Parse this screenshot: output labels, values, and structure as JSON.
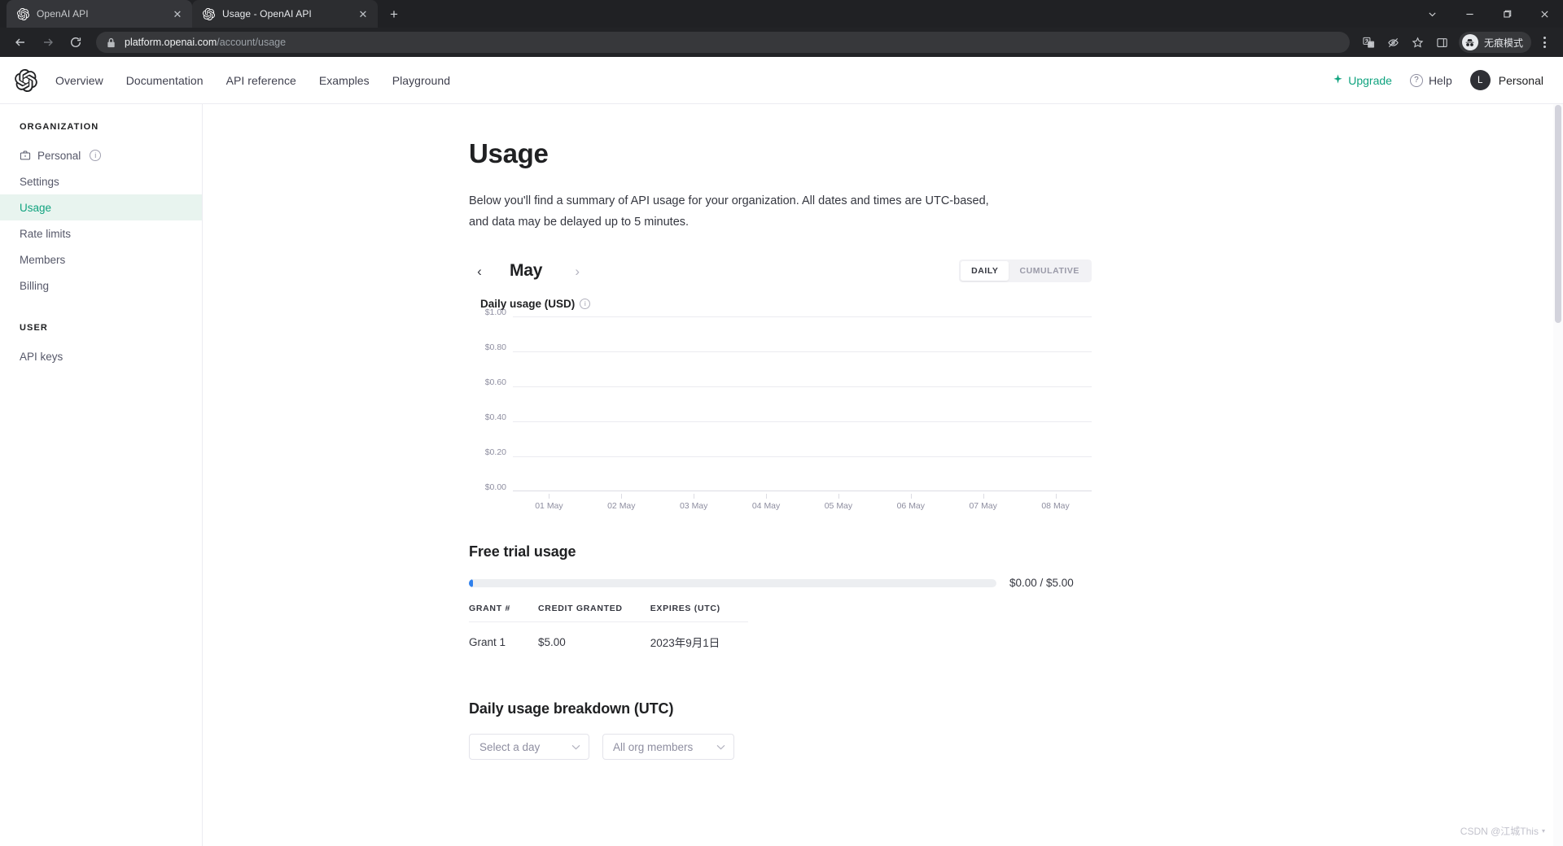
{
  "browser": {
    "tabs": [
      {
        "title": "OpenAI API",
        "favicon": "openai-icon",
        "active": false
      },
      {
        "title": "Usage - OpenAI API",
        "favicon": "openai-icon",
        "active": true
      }
    ],
    "new_tab_label": "+",
    "window_controls": [
      "chevron-down-icon",
      "minimize-icon",
      "maximize-icon",
      "close-icon"
    ],
    "nav": {
      "back": "back-arrow-icon",
      "forward": "forward-arrow-icon",
      "reload": "reload-icon"
    },
    "url": {
      "lock": "lock-icon",
      "domain": "platform.openai.com",
      "path": "/account/usage"
    },
    "toolbar_icons": [
      "translate-icon",
      "eye-slash-icon",
      "bookmark-star-icon",
      "side-panel-icon"
    ],
    "incognito_label": "无痕模式",
    "menu_label": "⋮"
  },
  "header": {
    "logo": "openai-logo",
    "nav": [
      {
        "label": "Overview"
      },
      {
        "label": "Documentation"
      },
      {
        "label": "API reference"
      },
      {
        "label": "Examples"
      },
      {
        "label": "Playground"
      }
    ],
    "upgrade": "Upgrade",
    "help": "Help",
    "avatar_initial": "L",
    "account": "Personal"
  },
  "sidebar": {
    "org_heading": "ORGANIZATION",
    "org_items": [
      {
        "label": "Personal",
        "icon": "briefcase-icon",
        "info": true,
        "active": false
      },
      {
        "label": "Settings",
        "active": false
      },
      {
        "label": "Usage",
        "active": true
      },
      {
        "label": "Rate limits",
        "active": false
      },
      {
        "label": "Members",
        "active": false
      },
      {
        "label": "Billing",
        "active": false
      }
    ],
    "user_heading": "USER",
    "user_items": [
      {
        "label": "API keys",
        "active": false
      }
    ],
    "active_color": "#10a37f",
    "active_bg": "#e8f4ef"
  },
  "main": {
    "title": "Usage",
    "description": "Below you'll find a summary of API usage for your organization. All dates and times are UTC-based, and data may be delayed up to 5 minutes.",
    "month": "May",
    "prev_icon": "chevron-left-icon",
    "next_icon": "chevron-right-icon",
    "toggle": {
      "daily": "DAILY",
      "cumulative": "CUMULATIVE",
      "selected": "DAILY"
    },
    "chart_label": "Daily usage (USD)",
    "free_trial": {
      "heading": "Free trial usage",
      "used": "$0.00",
      "total": "$5.00",
      "value_text": "$0.00 / $5.00",
      "percent": 0.8,
      "bar_color": "#2f80ed",
      "columns": [
        "GRANT #",
        "CREDIT GRANTED",
        "EXPIRES (UTC)"
      ],
      "rows": [
        [
          "Grant 1",
          "$5.00",
          "2023年9月1日"
        ]
      ]
    },
    "breakdown": {
      "heading": "Daily usage breakdown (UTC)",
      "day_select": "Select a day",
      "member_select": "All org members"
    }
  },
  "chart_data": {
    "type": "bar",
    "title": "Daily usage (USD)",
    "categories": [
      "01 May",
      "02 May",
      "03 May",
      "04 May",
      "05 May",
      "06 May",
      "07 May",
      "08 May"
    ],
    "values": [
      0,
      0,
      0,
      0,
      0,
      0,
      0,
      0
    ],
    "series": [
      {
        "name": "Daily usage (USD)",
        "values": [
          0,
          0,
          0,
          0,
          0,
          0,
          0,
          0
        ]
      }
    ],
    "xlabel": "",
    "ylabel": "",
    "ylim": [
      0,
      1.0
    ],
    "yticks": [
      "$0.00",
      "$0.20",
      "$0.40",
      "$0.60",
      "$0.80",
      "$1.00"
    ],
    "ytick_values": [
      0,
      0.2,
      0.4,
      0.6,
      0.8,
      1.0
    ],
    "grid": true,
    "legend": false
  },
  "watermark": "CSDN @江城This"
}
